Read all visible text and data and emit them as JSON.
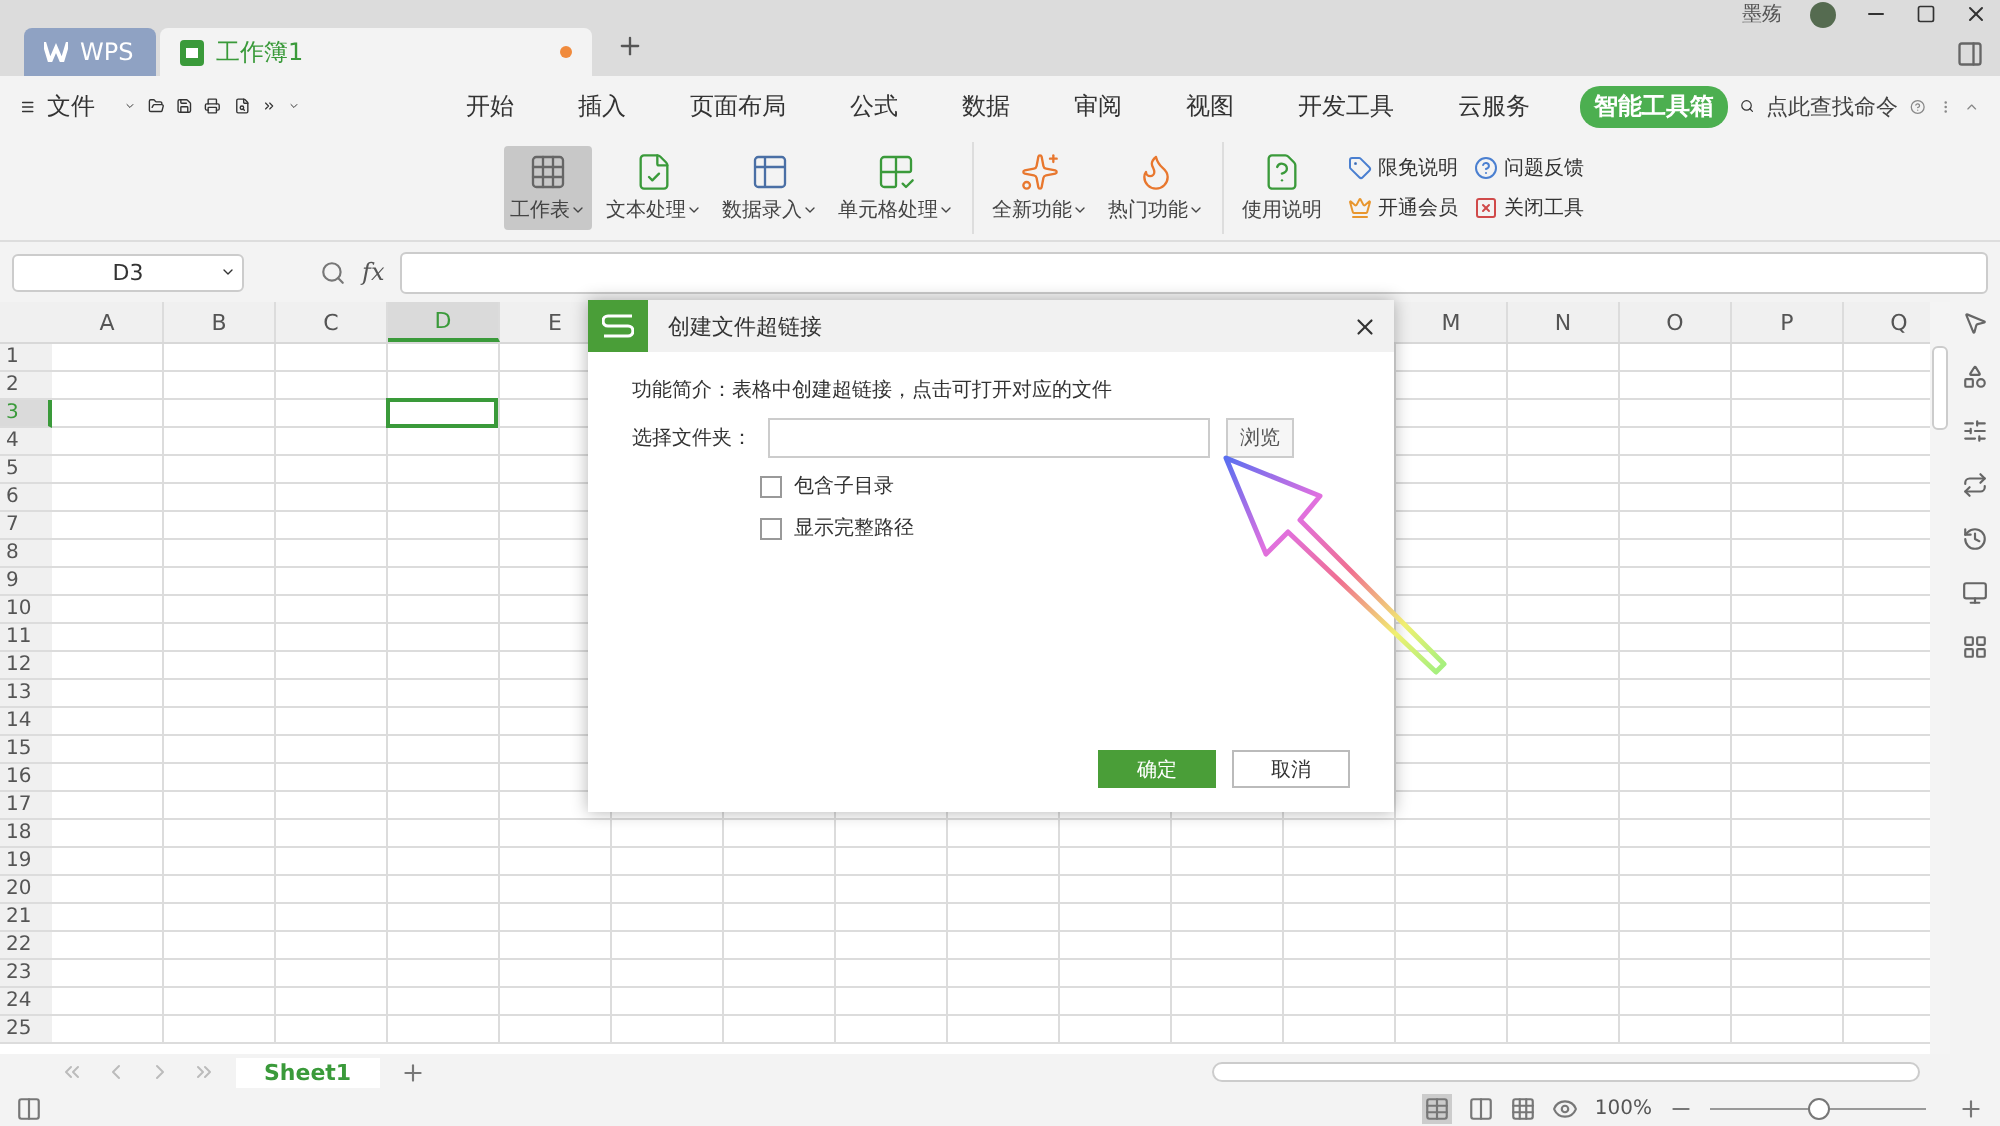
{
  "title_bar": {
    "tabs": [
      {
        "label": "WPS",
        "kind": "home",
        "selected": false,
        "unsaved": false
      },
      {
        "label": "工作簿1",
        "kind": "sheet",
        "selected": true,
        "unsaved": true
      }
    ],
    "user": "墨殇"
  },
  "menu": {
    "file": "文件",
    "tabs": [
      {
        "label": "开始",
        "selected": false
      },
      {
        "label": "插入",
        "selected": false
      },
      {
        "label": "页面布局",
        "selected": false
      },
      {
        "label": "公式",
        "selected": false
      },
      {
        "label": "数据",
        "selected": false
      },
      {
        "label": "审阅",
        "selected": false
      },
      {
        "label": "视图",
        "selected": false
      },
      {
        "label": "开发工具",
        "selected": false
      },
      {
        "label": "云服务",
        "selected": false
      },
      {
        "label": "智能工具箱",
        "selected": true
      }
    ],
    "search": "点此查找命令"
  },
  "ribbon": {
    "groups": [
      {
        "buttons": [
          {
            "label": "工作表",
            "kind": "sheet",
            "dropdown": true,
            "selected": true
          },
          {
            "label": "文本处理",
            "kind": "text",
            "dropdown": true,
            "selected": false
          },
          {
            "label": "数据录入",
            "kind": "entry",
            "dropdown": true,
            "selected": false
          },
          {
            "label": "单元格处理",
            "kind": "cell",
            "dropdown": true,
            "selected": false
          }
        ]
      },
      {
        "buttons": [
          {
            "label": "全新功能",
            "kind": "new",
            "dropdown": true,
            "selected": false
          },
          {
            "label": "热门功能",
            "kind": "hot",
            "dropdown": true,
            "selected": false
          }
        ]
      },
      {
        "buttons": [
          {
            "label": "使用说明",
            "kind": "manual",
            "dropdown": false,
            "selected": false
          }
        ]
      }
    ],
    "small": [
      {
        "label": "限免说明",
        "kind": "tag"
      },
      {
        "label": "问题反馈",
        "kind": "help"
      },
      {
        "label": "开通会员",
        "kind": "crown"
      },
      {
        "label": "关闭工具",
        "kind": "close"
      }
    ]
  },
  "formula_bar": {
    "name_box": "D3",
    "fx": "fx"
  },
  "sheet": {
    "columns_left": [
      {
        "label": "A",
        "selected": false
      },
      {
        "label": "B",
        "selected": false
      },
      {
        "label": "C",
        "selected": false
      },
      {
        "label": "D",
        "selected": true
      },
      {
        "label": "E",
        "selected": false
      }
    ],
    "columns_right": [
      {
        "label": "M",
        "selected": false
      },
      {
        "label": "N",
        "selected": false
      },
      {
        "label": "O",
        "selected": false
      },
      {
        "label": "P",
        "selected": false
      },
      {
        "label": "Q",
        "selected": false
      }
    ],
    "rows": [
      {
        "label": "1",
        "selected": false
      },
      {
        "label": "2",
        "selected": false
      },
      {
        "label": "3",
        "selected": true
      },
      {
        "label": "4",
        "selected": false
      },
      {
        "label": "5",
        "selected": false
      },
      {
        "label": "6",
        "selected": false
      },
      {
        "label": "7",
        "selected": false
      },
      {
        "label": "8",
        "selected": false
      },
      {
        "label": "9",
        "selected": false
      },
      {
        "label": "10",
        "selected": false
      },
      {
        "label": "11",
        "selected": false
      },
      {
        "label": "12",
        "selected": false
      },
      {
        "label": "13",
        "selected": false
      },
      {
        "label": "14",
        "selected": false
      },
      {
        "label": "15",
        "selected": false
      },
      {
        "label": "16",
        "selected": false
      },
      {
        "label": "17",
        "selected": false
      },
      {
        "label": "18",
        "selected": false
      },
      {
        "label": "19",
        "selected": false
      },
      {
        "label": "20",
        "selected": false
      },
      {
        "label": "21",
        "selected": false
      },
      {
        "label": "22",
        "selected": false
      },
      {
        "label": "23",
        "selected": false
      },
      {
        "label": "24",
        "selected": false
      },
      {
        "label": "25",
        "selected": false
      }
    ]
  },
  "dialog": {
    "title": "创建文件超链接",
    "description": "功能简介：表格中创建超链接，点击可打开对应的文件",
    "folder_label": "选择文件夹：",
    "browse": "浏览",
    "options": [
      {
        "label": "包含子目录",
        "checked": false
      },
      {
        "label": "显示完整路径",
        "checked": false
      }
    ],
    "ok": "确定",
    "cancel": "取消"
  },
  "sheet_tabs": [
    {
      "label": "Sheet1",
      "selected": true
    }
  ],
  "status_bar": {
    "zoom": "100%",
    "zoom_slider": {
      "level": 0.5
    }
  }
}
